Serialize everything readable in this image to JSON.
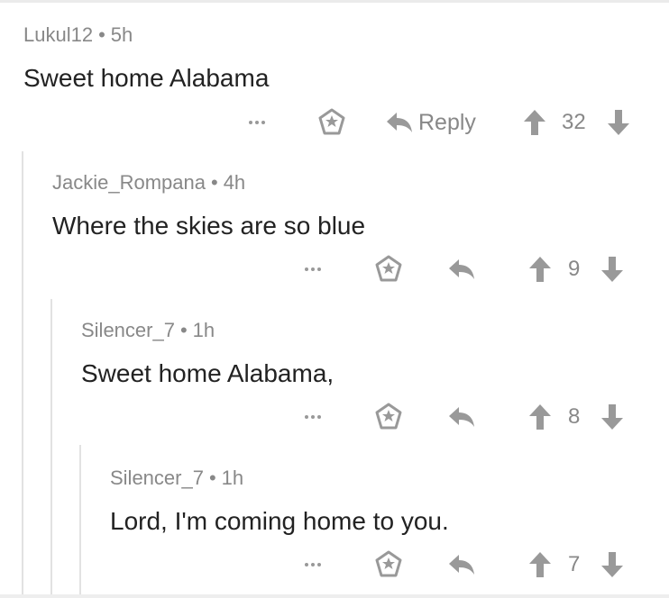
{
  "comments": [
    {
      "author": "Lukul12",
      "separator": "•",
      "time": "5h",
      "text": "Sweet home Alabama",
      "reply_label": "Reply",
      "score": "32"
    },
    {
      "author": "Jackie_Rompana",
      "separator": "•",
      "time": "4h",
      "text": "Where the skies are so blue",
      "reply_label": "",
      "score": "9"
    },
    {
      "author": "Silencer_7",
      "separator": "•",
      "time": "1h",
      "text": "Sweet home Alabama,",
      "reply_label": "",
      "score": "8"
    },
    {
      "author": "Silencer_7",
      "separator": "•",
      "time": "1h",
      "text": "Lord, I'm coming home to you.",
      "reply_label": "",
      "score": "7"
    }
  ],
  "icons": {
    "more": "more-options-icon",
    "award": "award-icon",
    "reply": "reply-arrow-icon",
    "upvote": "upvote-arrow-icon",
    "downvote": "downvote-arrow-icon"
  },
  "colors": {
    "text": "#222222",
    "meta": "#888888",
    "icon": "#999999",
    "thread_line": "#e2e2e2"
  }
}
